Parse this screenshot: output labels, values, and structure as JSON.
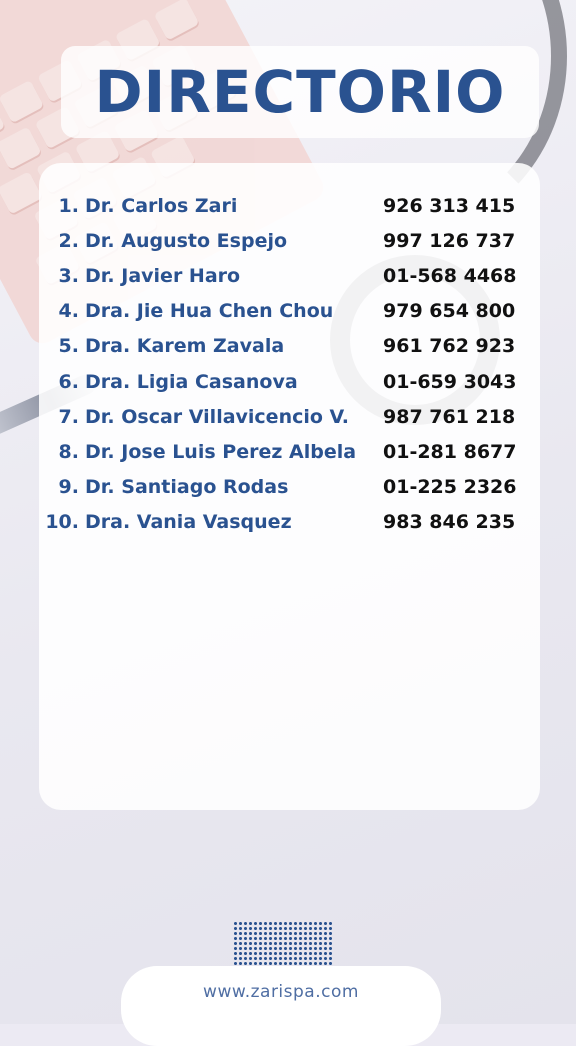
{
  "title": "DIRECTORIO",
  "doctors": [
    {
      "num": "1.",
      "name": "Dr. Carlos Zari",
      "phone": "926 313 415"
    },
    {
      "num": "2.",
      "name": "Dr. Augusto Espejo",
      "phone": "997 126 737"
    },
    {
      "num": "3.",
      "name": "Dr. Javier Haro",
      "phone": "01-568 4468"
    },
    {
      "num": "4.",
      "name": "Dra. Jie Hua Chen Chou",
      "phone": "979 654 800"
    },
    {
      "num": "5.",
      "name": "Dra. Karem Zavala",
      "phone": "961 762 923"
    },
    {
      "num": "6.",
      "name": "Dra. Ligia Casanova",
      "phone": "01-659 3043"
    },
    {
      "num": "7.",
      "name": "Dr. Oscar Villavicencio V.",
      "phone": "987 761 218"
    },
    {
      "num": "8.",
      "name": "Dr. Jose Luis Perez Albela",
      "phone": "01-281 8677"
    },
    {
      "num": "9.",
      "name": "Dr. Santiago Rodas",
      "phone": "01-225 2326"
    },
    {
      "num": "10.",
      "name": "Dra. Vania Vasquez",
      "phone": "983 846 235"
    }
  ],
  "footer": {
    "website": "www.zarispa.com"
  },
  "colors": {
    "accent": "#2a5290",
    "phone_text": "#111111",
    "footer_text": "#4f6ea3"
  }
}
